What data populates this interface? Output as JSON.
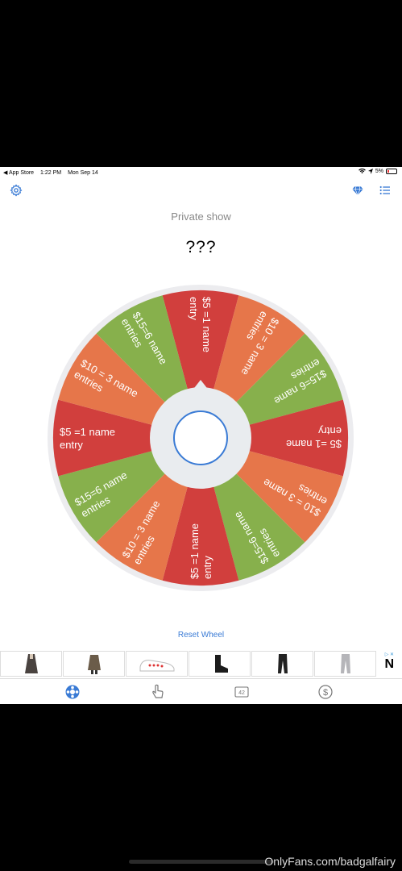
{
  "status_bar": {
    "back_app": "◀ App Store",
    "time": "1:22 PM",
    "date": "Mon Sep 14",
    "battery": "5%"
  },
  "title": "Private show",
  "result": "???",
  "wheel": {
    "segments": [
      {
        "label": "$5 =1 name entry",
        "color": "#d13f3d"
      },
      {
        "label": "$10 = 3 name entries",
        "color": "#e6764a"
      },
      {
        "label": "$15=6 name entries",
        "color": "#87b04c"
      },
      {
        "label": "$5 =1 name entry",
        "color": "#d13f3d"
      },
      {
        "label": "$10 = 3 name entries",
        "color": "#e6764a"
      },
      {
        "label": "$15=6 name entries",
        "color": "#87b04c"
      },
      {
        "label": "$5 =1 name entry",
        "color": "#d13f3d"
      },
      {
        "label": "$10 = 3 name entries",
        "color": "#e6764a"
      },
      {
        "label": "$15=6 name entries",
        "color": "#87b04c"
      },
      {
        "label": "$5 =1 name entry",
        "color": "#d13f3d"
      },
      {
        "label": "$10 = 3 name entries",
        "color": "#e6764a"
      },
      {
        "label": "$15=6 name entries",
        "color": "#87b04c"
      }
    ]
  },
  "reset_label": "Reset Wheel",
  "ad": {
    "choices_label": "▷ ✕",
    "logo": "N",
    "items": [
      "coat",
      "jacket",
      "sneakers",
      "boots",
      "pants",
      "jeans"
    ]
  },
  "tabbar": {
    "tabs": [
      {
        "name": "wheel-tab",
        "icon": "wheel-icon",
        "active": true
      },
      {
        "name": "tap-tab",
        "icon": "tap-hand-icon",
        "active": false
      },
      {
        "name": "number-tab",
        "icon": "number-icon",
        "label": "42",
        "active": false
      },
      {
        "name": "coins-tab",
        "icon": "dollar-icon",
        "active": false
      }
    ]
  },
  "watermark": "OnlyFans.com/badgalfairy",
  "colors": {
    "accent": "#3a7bd5",
    "red": "#d13f3d",
    "orange": "#e6764a",
    "green": "#87b04c"
  }
}
